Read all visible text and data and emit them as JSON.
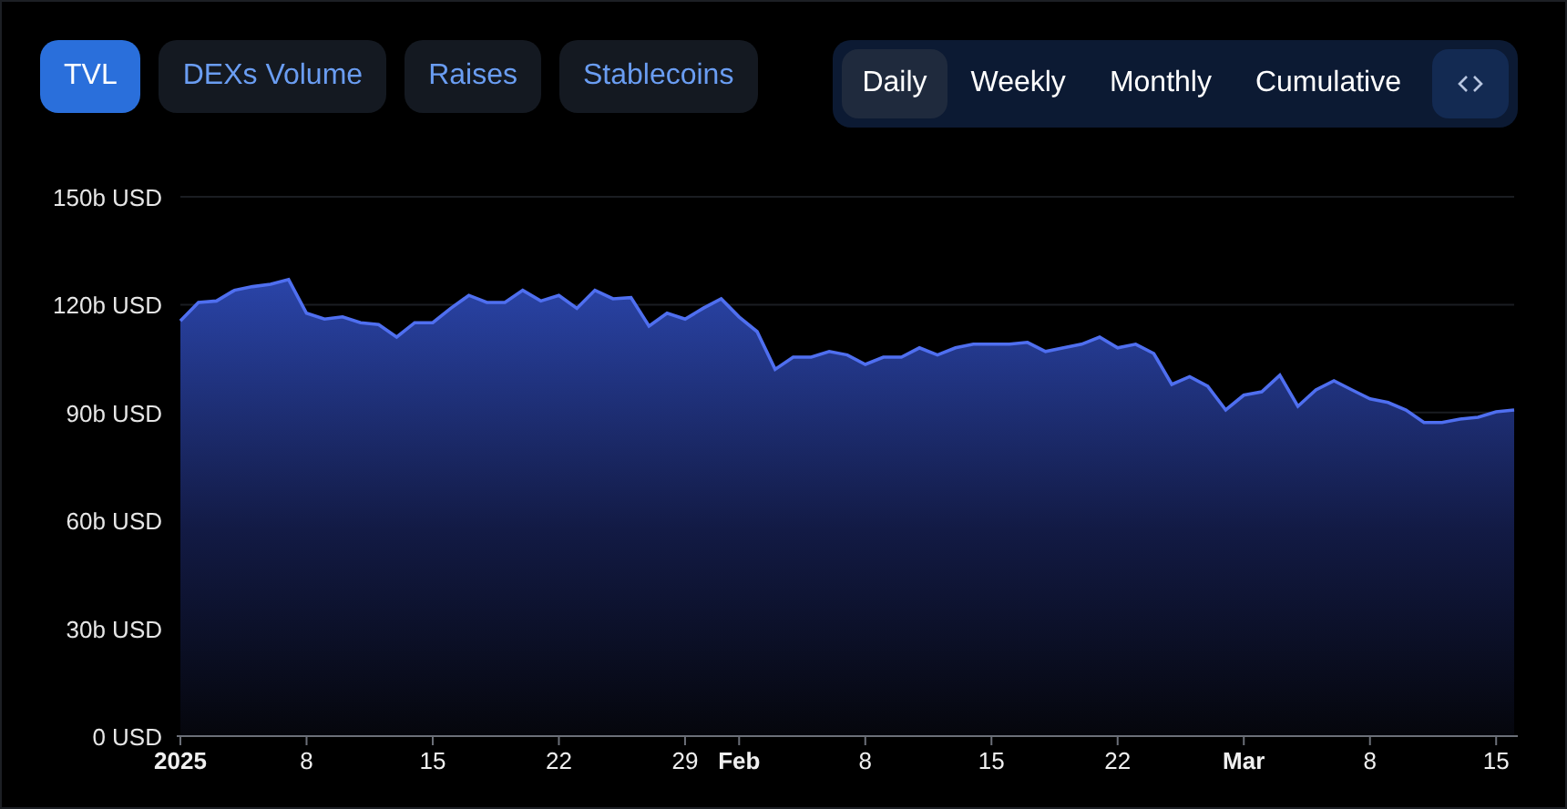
{
  "metric_tabs": [
    {
      "label": "TVL",
      "selected": true
    },
    {
      "label": "DEXs Volume",
      "selected": false
    },
    {
      "label": "Raises",
      "selected": false
    },
    {
      "label": "Stablecoins",
      "selected": false
    }
  ],
  "period_tabs": [
    {
      "label": "Daily",
      "selected": true
    },
    {
      "label": "Weekly",
      "selected": false
    },
    {
      "label": "Monthly",
      "selected": false
    },
    {
      "label": "Cumulative",
      "selected": false
    }
  ],
  "chart_data": {
    "type": "area",
    "categories": [
      "2025",
      null,
      null,
      null,
      null,
      null,
      null,
      "8",
      null,
      null,
      null,
      null,
      null,
      null,
      "15",
      null,
      null,
      null,
      null,
      null,
      null,
      "22",
      null,
      null,
      null,
      null,
      null,
      null,
      "29",
      null,
      null,
      "Feb",
      null,
      null,
      null,
      null,
      null,
      null,
      "8",
      null,
      null,
      null,
      null,
      null,
      null,
      "15",
      null,
      null,
      null,
      null,
      null,
      null,
      "22",
      null,
      null,
      null,
      null,
      null,
      null,
      "Mar",
      null,
      null,
      null,
      null,
      null,
      null,
      "8",
      null,
      null,
      null,
      null,
      null,
      null,
      "15",
      null
    ],
    "series": [
      {
        "color": "#4f6ff0",
        "values": [
          115.5,
          120.6,
          121,
          124,
          125,
          125.7,
          127,
          117.6,
          116,
          116.6,
          115,
          114.5,
          111,
          115,
          115,
          119,
          122.6,
          120.6,
          120.6,
          124,
          121,
          122.6,
          119,
          124,
          121.6,
          122,
          114,
          117.6,
          116,
          119,
          121.6,
          116.6,
          112.5,
          102,
          105.4,
          105.4,
          107,
          106,
          103.4,
          105.4,
          105.4,
          108,
          106,
          108,
          109,
          109,
          109,
          109.5,
          107,
          108,
          109,
          111,
          108,
          109,
          106.4,
          97.8,
          100,
          97.3,
          90.7,
          94.8,
          95.8,
          100.4,
          91.7,
          96.3,
          98.8,
          96.3,
          93.8,
          92.8,
          90.7,
          87.2,
          87.2,
          88.2,
          88.7,
          90.2,
          90.7
        ]
      }
    ],
    "ylim": [
      0,
      150
    ],
    "yticks": [
      {
        "value": 0,
        "label": "0 USD"
      },
      {
        "value": 30,
        "label": "30b USD"
      },
      {
        "value": 60,
        "label": "60b USD"
      },
      {
        "value": 90,
        "label": "90b USD"
      },
      {
        "value": 120,
        "label": "120b USD"
      },
      {
        "value": 150,
        "label": "150b USD"
      }
    ]
  }
}
